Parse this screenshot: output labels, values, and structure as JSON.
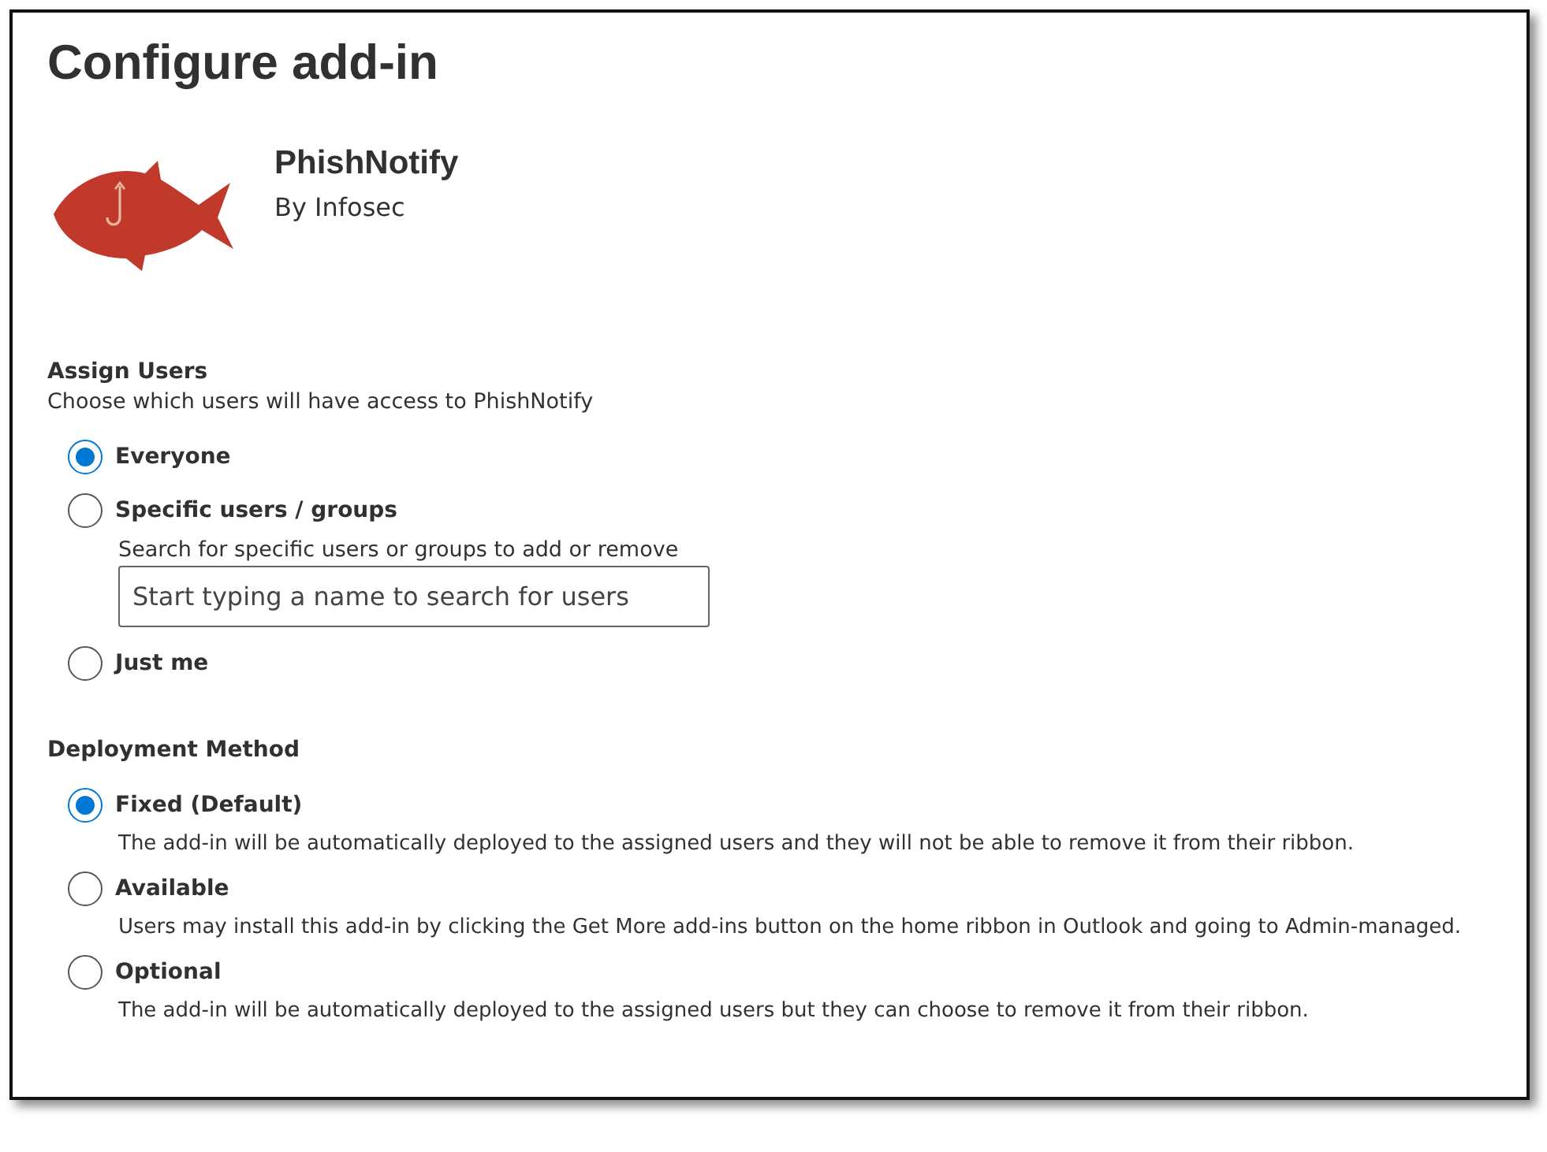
{
  "title": "Configure add-in",
  "addin": {
    "name": "PhishNotify",
    "publisher": "By Infosec"
  },
  "assign_users": {
    "heading": "Assign Users",
    "description": "Choose which users will have access to PhishNotify",
    "options": [
      {
        "label": "Everyone",
        "selected": true
      },
      {
        "label": "Specific users / groups",
        "selected": false,
        "search_label": "Search for specific users or groups to add or remove",
        "search": {
          "placeholder": "Start typing a name to search for users"
        }
      },
      {
        "label": "Just me",
        "selected": false
      }
    ]
  },
  "deployment_method": {
    "heading": "Deployment Method",
    "options": [
      {
        "label": "Fixed (Default)",
        "selected": true,
        "description": "The add-in will be automatically deployed to the assigned users and they will not be able to remove it from their ribbon."
      },
      {
        "label": "Available",
        "selected": false,
        "description": "Users may install this add-in by clicking the Get More add-ins button on the home ribbon in Outlook and going to Admin-managed."
      },
      {
        "label": "Optional",
        "selected": false,
        "description": "The add-in will be automatically deployed to the assigned users but they can choose to remove it from their ribbon."
      }
    ]
  }
}
